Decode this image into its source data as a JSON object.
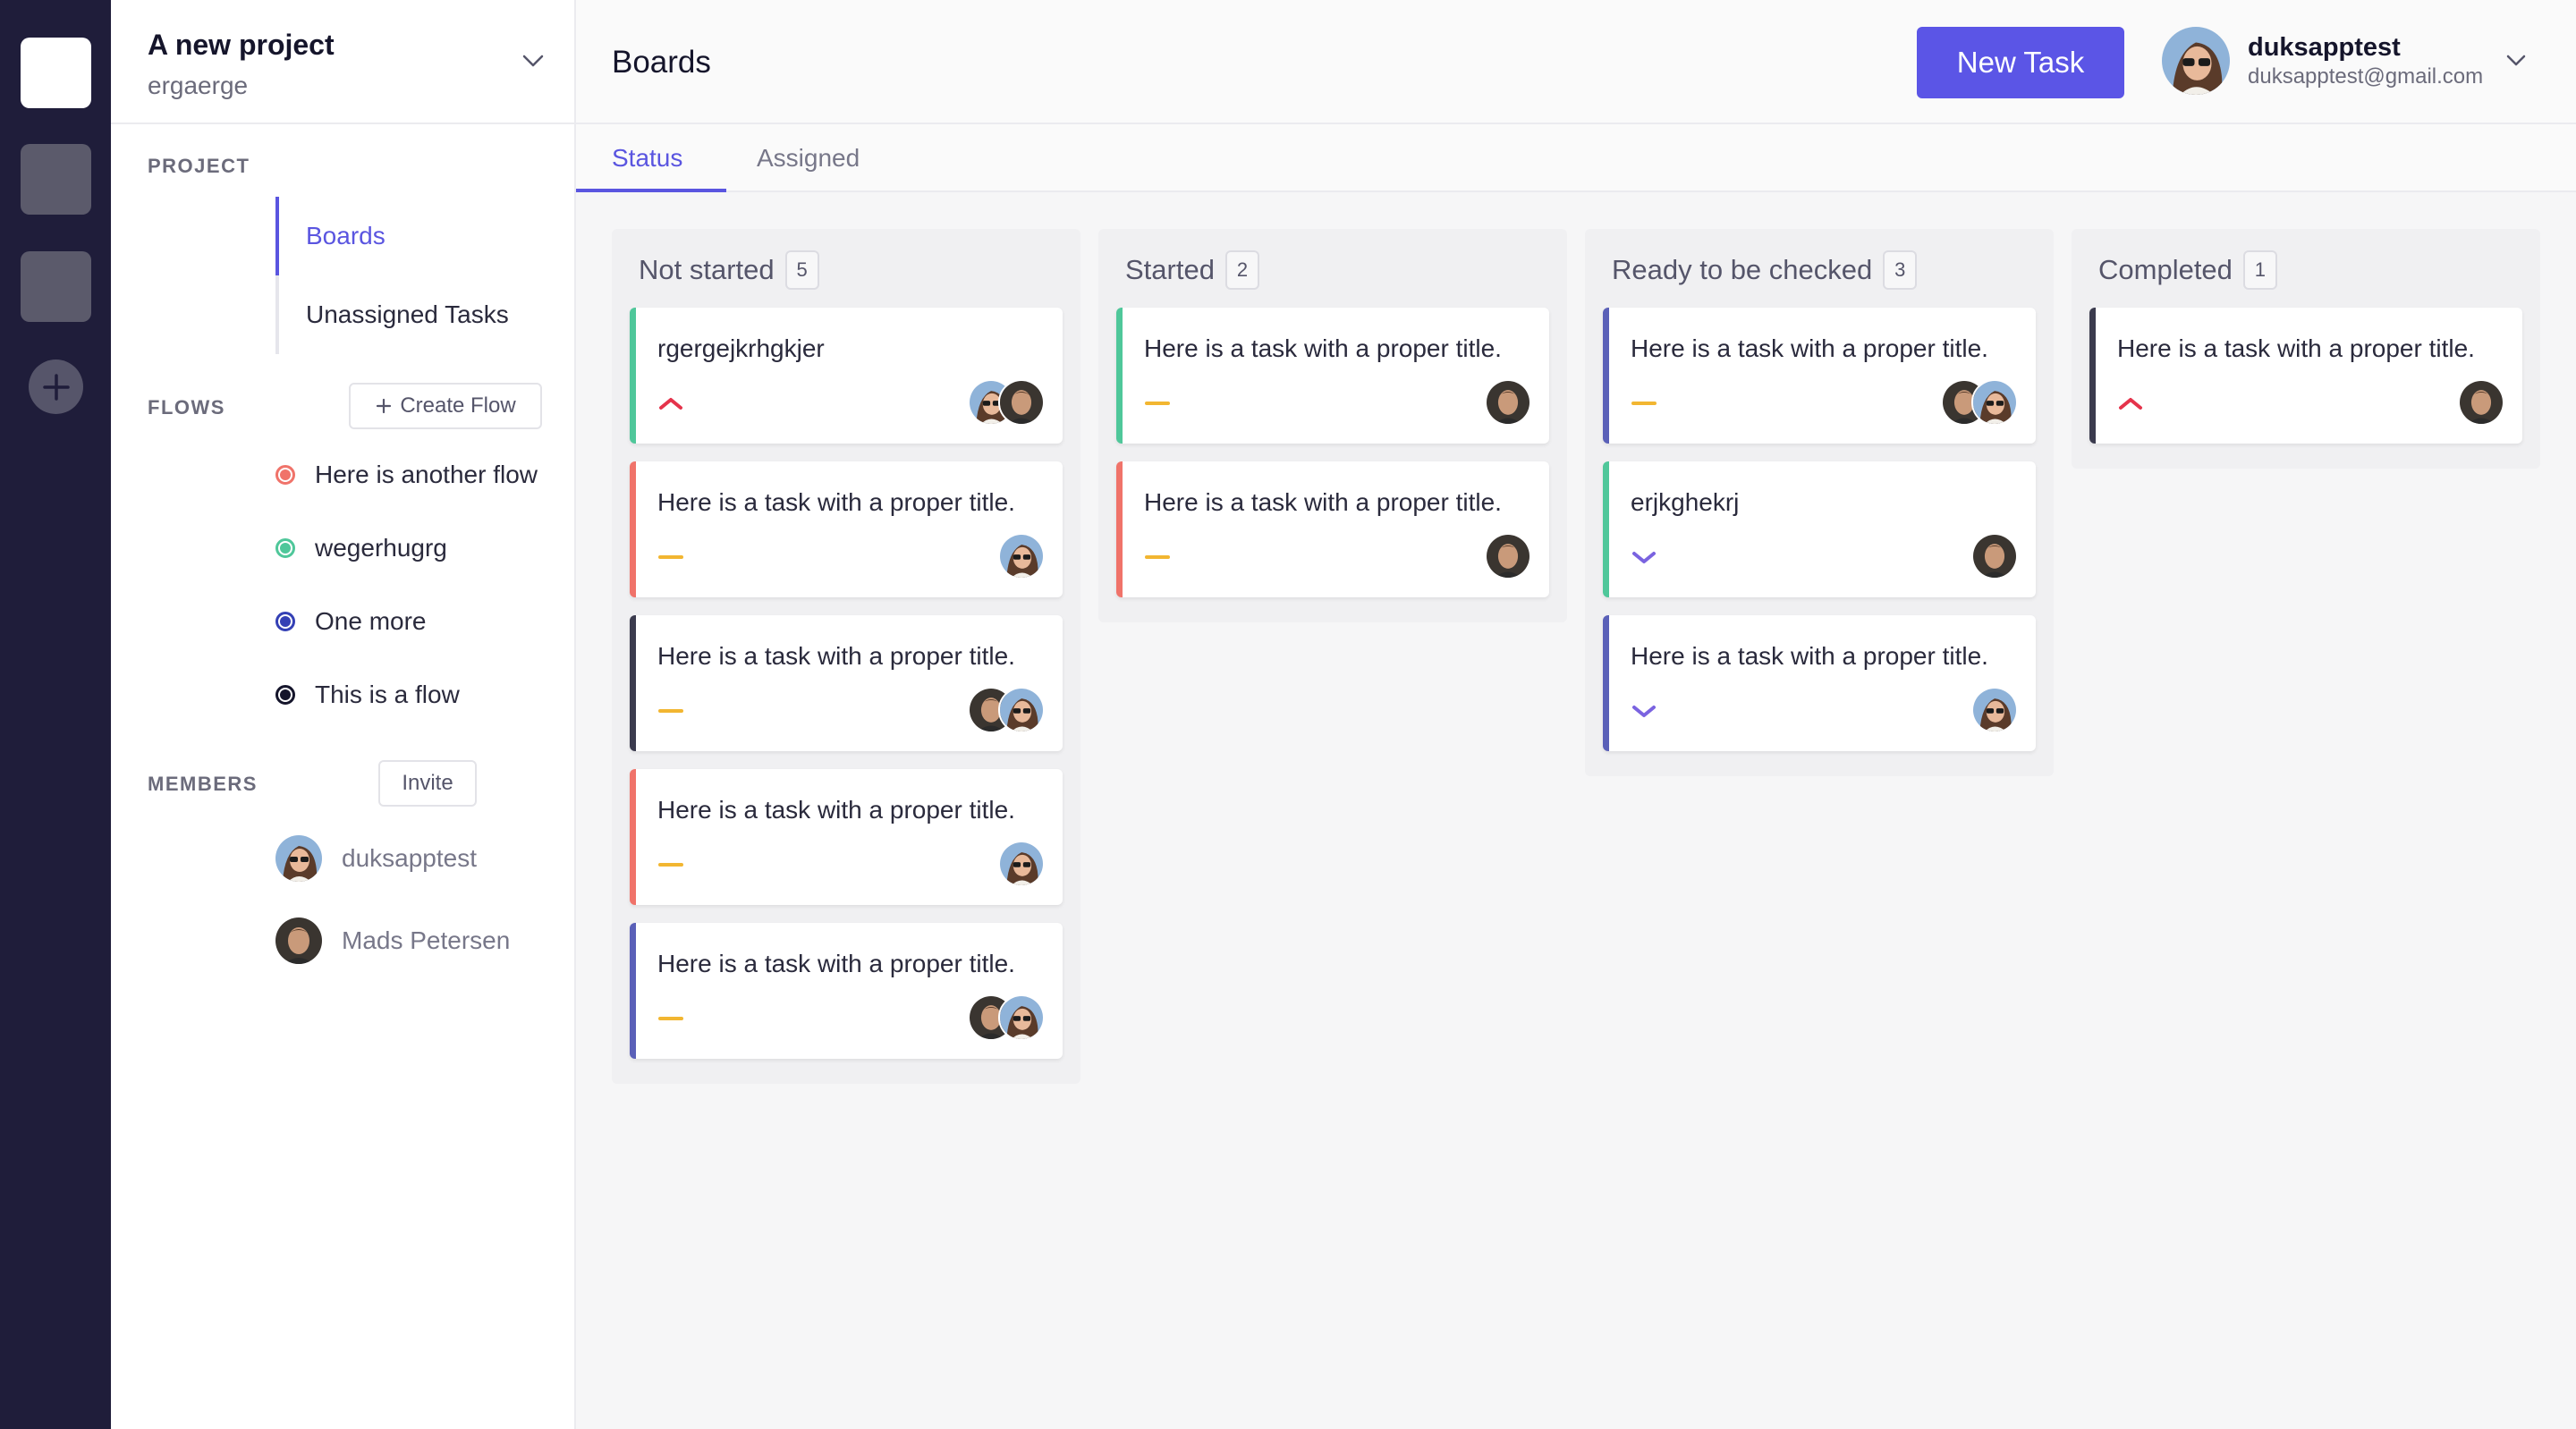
{
  "workspace_rail": {
    "workspaces": [
      "active",
      "second",
      "third"
    ],
    "add_icon": "plus-icon"
  },
  "sidebar": {
    "project_name": "A new project",
    "project_subtitle": "ergaerge",
    "project_section_label": "PROJECT",
    "nav": [
      {
        "label": "Boards",
        "active": true
      },
      {
        "label": "Unassigned Tasks",
        "active": false
      }
    ],
    "flows_label": "FLOWS",
    "create_flow_label": "Create Flow",
    "flows": [
      {
        "label": "Here is another flow",
        "color": "#f0736a"
      },
      {
        "label": "wegerhugrg",
        "color": "#4fc79a"
      },
      {
        "label": "One more",
        "color": "#3440b5"
      },
      {
        "label": "This is a flow",
        "color": "#15152b"
      }
    ],
    "members_label": "MEMBERS",
    "invite_label": "Invite",
    "members": [
      {
        "name": "duksapptest",
        "avatar": "woman"
      },
      {
        "name": "Mads Petersen",
        "avatar": "man"
      }
    ]
  },
  "header": {
    "title": "Boards",
    "new_task_label": "New Task",
    "user_name": "duksapptest",
    "user_email": "duksapptest@gmail.com"
  },
  "tabs": [
    {
      "label": "Status",
      "active": true
    },
    {
      "label": "Assigned",
      "active": false
    }
  ],
  "colors": {
    "accent": "#5b55e6",
    "priority_high": "#e5334b",
    "priority_medium": "#f2b631",
    "priority_low": "#7a63e0"
  },
  "columns": [
    {
      "title": "Not started",
      "count": "5",
      "cards": [
        {
          "title": "rgergejkrhgkjer",
          "flow_color": "#4fc79a",
          "priority": "high",
          "assignees": [
            "woman",
            "man"
          ]
        },
        {
          "title": "Here is a task with a proper title.",
          "flow_color": "#f0736a",
          "priority": "medium",
          "assignees": [
            "woman"
          ]
        },
        {
          "title": "Here is a task with a proper title.",
          "flow_color": "#3b3b4e",
          "priority": "medium",
          "assignees": [
            "man",
            "woman"
          ]
        },
        {
          "title": "Here is a task with a proper title.",
          "flow_color": "#f0736a",
          "priority": "medium",
          "assignees": [
            "woman"
          ]
        },
        {
          "title": "Here is a task with a proper title.",
          "flow_color": "#5a60b8",
          "priority": "medium",
          "assignees": [
            "man",
            "woman"
          ]
        }
      ]
    },
    {
      "title": "Started",
      "count": "2",
      "cards": [
        {
          "title": "Here is a task with a proper title.",
          "flow_color": "#4fc79a",
          "priority": "medium",
          "assignees": [
            "man"
          ]
        },
        {
          "title": "Here is a task with a proper title.",
          "flow_color": "#f0736a",
          "priority": "medium",
          "assignees": [
            "man"
          ]
        }
      ]
    },
    {
      "title": "Ready to be checked",
      "count": "3",
      "cards": [
        {
          "title": "Here is a task with a proper title.",
          "flow_color": "#5a60b8",
          "priority": "medium",
          "assignees": [
            "man",
            "woman"
          ]
        },
        {
          "title": "erjkghekrj",
          "flow_color": "#4fc79a",
          "priority": "low",
          "assignees": [
            "man"
          ]
        },
        {
          "title": "Here is a task with a proper title.",
          "flow_color": "#5a60b8",
          "priority": "low",
          "assignees": [
            "woman"
          ]
        }
      ]
    },
    {
      "title": "Completed",
      "count": "1",
      "cards": [
        {
          "title": "Here is a task with a proper title.",
          "flow_color": "#3b3b4e",
          "priority": "high",
          "assignees": [
            "man"
          ]
        }
      ]
    }
  ]
}
